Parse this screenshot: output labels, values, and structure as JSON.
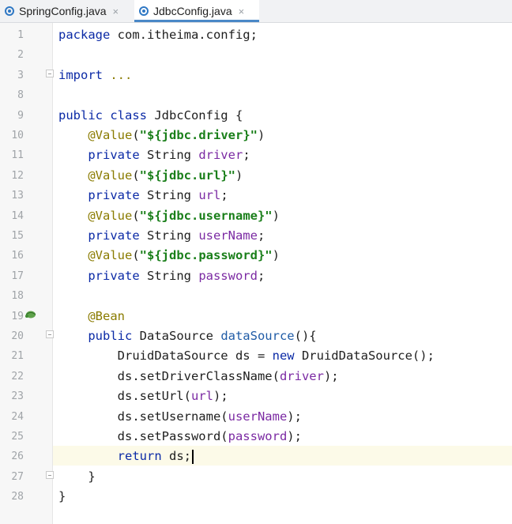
{
  "tabs": [
    {
      "label": "SpringConfig.java",
      "close": "×"
    },
    {
      "label": "JdbcConfig.java",
      "close": "×"
    }
  ],
  "lines": [
    {
      "num": "1",
      "code": [
        [
          "kw",
          "package"
        ],
        [
          "t",
          " com.itheima.config;"
        ]
      ]
    },
    {
      "num": "2",
      "code": []
    },
    {
      "num": "3",
      "code": [
        [
          "kw",
          "import"
        ],
        [
          "t",
          " "
        ],
        [
          "ann",
          "..."
        ]
      ]
    },
    {
      "num": "8",
      "code": []
    },
    {
      "num": "9",
      "code": [
        [
          "kw",
          "public class"
        ],
        [
          "t",
          " JdbcConfig {"
        ]
      ]
    },
    {
      "num": "10",
      "code": [
        [
          "t",
          "    "
        ],
        [
          "ann",
          "@Value"
        ],
        [
          "t",
          "("
        ],
        [
          "str",
          "\"${jdbc.driver}\""
        ],
        [
          "t",
          ")"
        ]
      ]
    },
    {
      "num": "11",
      "code": [
        [
          "t",
          "    "
        ],
        [
          "kw",
          "private"
        ],
        [
          "t",
          " String "
        ],
        [
          "fld",
          "driver"
        ],
        [
          "t",
          ";"
        ]
      ]
    },
    {
      "num": "12",
      "code": [
        [
          "t",
          "    "
        ],
        [
          "ann",
          "@Value"
        ],
        [
          "t",
          "("
        ],
        [
          "str",
          "\"${jdbc.url}\""
        ],
        [
          "t",
          ")"
        ]
      ]
    },
    {
      "num": "13",
      "code": [
        [
          "t",
          "    "
        ],
        [
          "kw",
          "private"
        ],
        [
          "t",
          " String "
        ],
        [
          "fld",
          "url"
        ],
        [
          "t",
          ";"
        ]
      ]
    },
    {
      "num": "14",
      "code": [
        [
          "t",
          "    "
        ],
        [
          "ann",
          "@Value"
        ],
        [
          "t",
          "("
        ],
        [
          "str",
          "\"${jdbc.username}\""
        ],
        [
          "t",
          ")"
        ]
      ]
    },
    {
      "num": "15",
      "code": [
        [
          "t",
          "    "
        ],
        [
          "kw",
          "private"
        ],
        [
          "t",
          " String "
        ],
        [
          "fld",
          "userName"
        ],
        [
          "t",
          ";"
        ]
      ]
    },
    {
      "num": "16",
      "code": [
        [
          "t",
          "    "
        ],
        [
          "ann",
          "@Value"
        ],
        [
          "t",
          "("
        ],
        [
          "str",
          "\"${jdbc.password}\""
        ],
        [
          "t",
          ")"
        ]
      ]
    },
    {
      "num": "17",
      "code": [
        [
          "t",
          "    "
        ],
        [
          "kw",
          "private"
        ],
        [
          "t",
          " String "
        ],
        [
          "fld",
          "password"
        ],
        [
          "t",
          ";"
        ]
      ]
    },
    {
      "num": "18",
      "code": []
    },
    {
      "num": "19",
      "code": [
        [
          "t",
          "    "
        ],
        [
          "ann",
          "@Bean"
        ]
      ]
    },
    {
      "num": "20",
      "code": [
        [
          "t",
          "    "
        ],
        [
          "kw",
          "public"
        ],
        [
          "t",
          " DataSource "
        ],
        [
          "mth",
          "dataSource"
        ],
        [
          "t",
          "(){"
        ]
      ]
    },
    {
      "num": "21",
      "code": [
        [
          "t",
          "        DruidDataSource ds = "
        ],
        [
          "kw",
          "new"
        ],
        [
          "t",
          " DruidDataSource();"
        ]
      ]
    },
    {
      "num": "22",
      "code": [
        [
          "t",
          "        ds.setDriverClassName("
        ],
        [
          "fld",
          "driver"
        ],
        [
          "t",
          ");"
        ]
      ]
    },
    {
      "num": "23",
      "code": [
        [
          "t",
          "        ds.setUrl("
        ],
        [
          "fld",
          "url"
        ],
        [
          "t",
          ");"
        ]
      ]
    },
    {
      "num": "24",
      "code": [
        [
          "t",
          "        ds.setUsername("
        ],
        [
          "fld",
          "userName"
        ],
        [
          "t",
          ");"
        ]
      ]
    },
    {
      "num": "25",
      "code": [
        [
          "t",
          "        ds.setPassword("
        ],
        [
          "fld",
          "password"
        ],
        [
          "t",
          ");"
        ]
      ]
    },
    {
      "num": "26",
      "code": [
        [
          "t",
          "        "
        ],
        [
          "kw",
          "return"
        ],
        [
          "t",
          " ds;"
        ]
      ]
    },
    {
      "num": "27",
      "code": [
        [
          "t",
          "    }"
        ]
      ]
    },
    {
      "num": "28",
      "code": [
        [
          "t",
          "}"
        ]
      ]
    }
  ]
}
